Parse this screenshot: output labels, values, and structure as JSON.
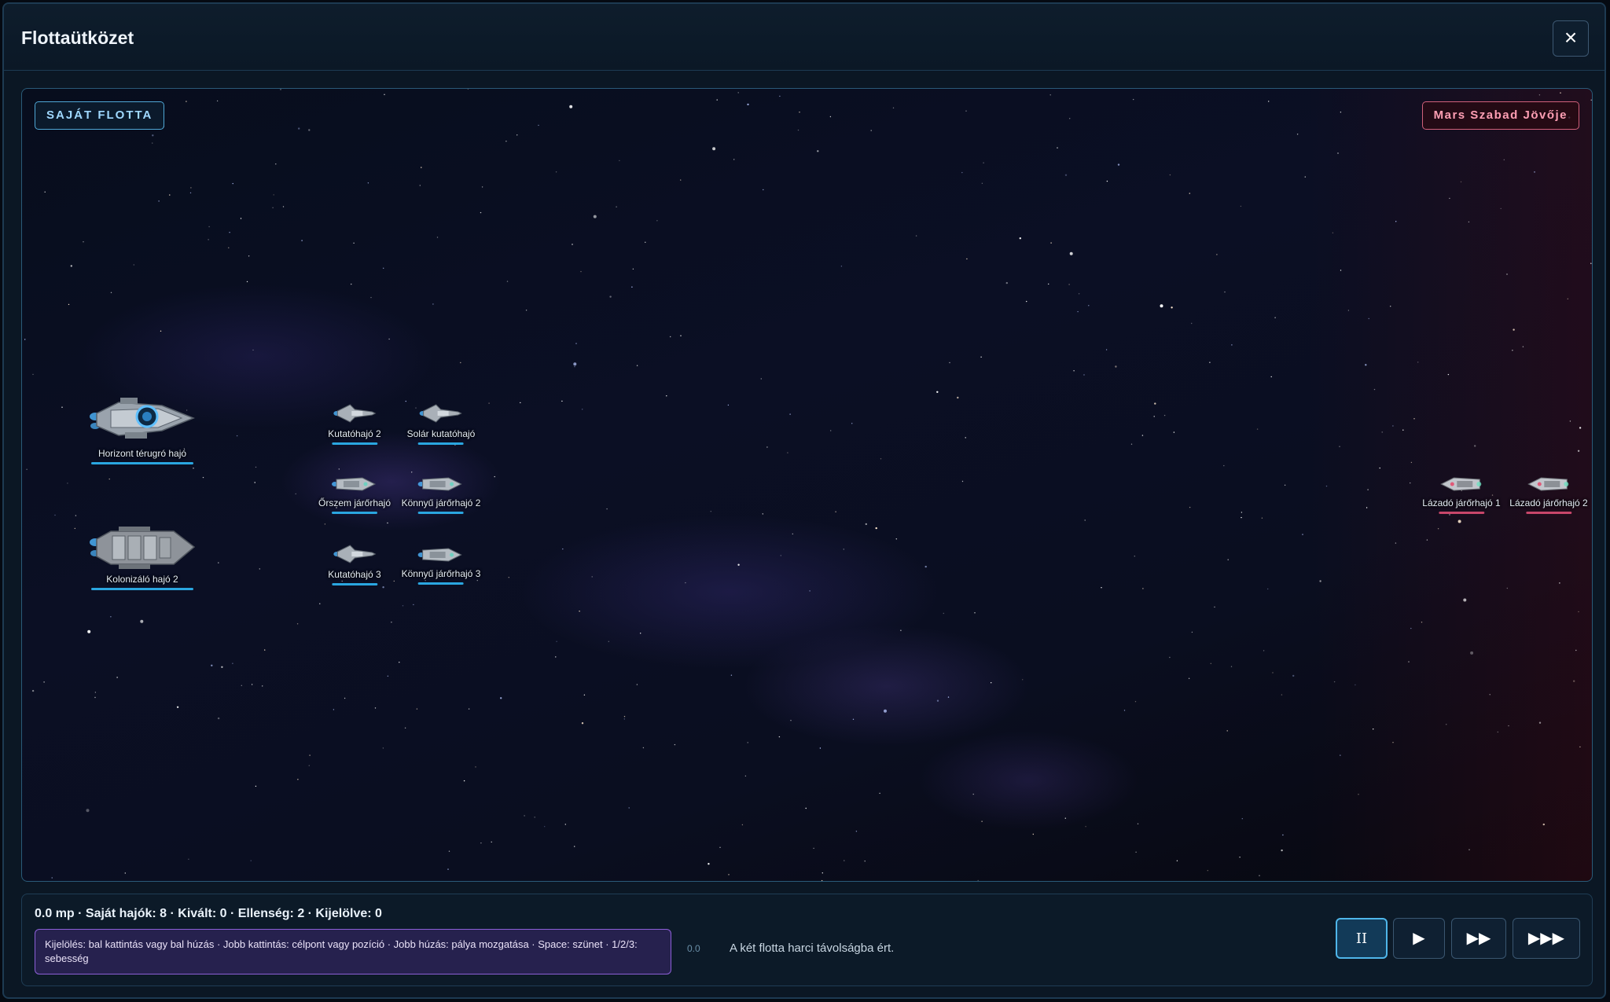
{
  "modal": {
    "title": "Flottaütközet",
    "close_icon": "×"
  },
  "battlefield": {
    "own_fleet_label": "SAJÁT FLOTTA",
    "enemy_fleet_label": "Mars Szabad Jövője",
    "own_ships": [
      {
        "name": "Horizont térugró hajó",
        "type": "large-cruiser"
      },
      {
        "name": "Kolonizáló hajó 2",
        "type": "large-freighter"
      },
      {
        "name": "Kutatóhajó 2",
        "type": "scout"
      },
      {
        "name": "Solár kutatóhajó",
        "type": "scout"
      },
      {
        "name": "Őrszem járőrhajó",
        "type": "patrol"
      },
      {
        "name": "Könnyű járőrhajó 2",
        "type": "patrol"
      },
      {
        "name": "Kutatóhajó 3",
        "type": "scout"
      },
      {
        "name": "Könnyű járőrhajó 3",
        "type": "patrol"
      }
    ],
    "enemy_ships": [
      {
        "name": "Lázadó járőrhajó 1",
        "type": "enemy-patrol"
      },
      {
        "name": "Lázadó járőrhajó 2",
        "type": "enemy-patrol"
      }
    ]
  },
  "bottom": {
    "status": "0.0 mp · Saját hajók: 8 · Kivált: 0 · Ellenség: 2 · Kijelölve: 0",
    "help": "Kijelölés: bal kattintás vagy bal húzás · Jobb kattintás: célpont vagy pozíció · Jobb húzás: pálya mozgatása · Space: szünet · 1/2/3: sebesség",
    "log_time": "0.0",
    "log_message": "A két flotta harci távolságba ért.",
    "controls": [
      {
        "icon": "pause-icon",
        "glyph": "II",
        "active": true
      },
      {
        "icon": "play-icon",
        "glyph": "▶",
        "active": false
      },
      {
        "icon": "fast-forward-icon",
        "glyph": "▶▶",
        "active": false
      },
      {
        "icon": "fastest-forward-icon",
        "glyph": "▶▶▶",
        "active": false
      }
    ]
  },
  "colors": {
    "own_accent": "#2aa6e0",
    "enemy_accent": "#c8466a",
    "help_border": "#8c5fd6"
  }
}
